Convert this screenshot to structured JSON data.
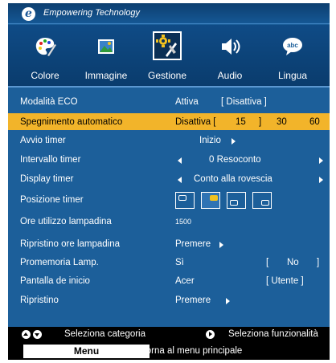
{
  "header": {
    "logo_letter": "e",
    "tagline": "Empowering Technology"
  },
  "tabs": [
    {
      "label": "Colore",
      "icon": "color-palette-icon"
    },
    {
      "label": "Immagine",
      "icon": "image-icon"
    },
    {
      "label": "Gestione",
      "icon": "management-tools-icon",
      "selected": true
    },
    {
      "label": "Audio",
      "icon": "speaker-icon"
    },
    {
      "label": "Lingua",
      "icon": "language-abc-icon"
    }
  ],
  "menu": {
    "eco_mode": {
      "label": "Modalità ECO",
      "on": "Attiva",
      "off": "[ Disattiva ]"
    },
    "auto_shutdown": {
      "label": "Spegnimento automatico",
      "v1": "Disattiva [",
      "v2": "15",
      "v3": "]",
      "v4": "30",
      "v5": "60"
    },
    "timer_start": {
      "label": "Avvio timer",
      "value": "Inizio"
    },
    "timer_interval": {
      "label": "Intervallo timer",
      "value": "0 Resoconto"
    },
    "timer_display": {
      "label": "Display timer",
      "value": "Conto alla rovescia"
    },
    "timer_position": {
      "label": "Posizione timer",
      "selected_index": 1
    },
    "lamp_hours": {
      "label": "Ore utilizzo lampadina",
      "value": "1500"
    },
    "lamp_reset": {
      "label": "Ripristino ore lampadina",
      "value": "Premere"
    },
    "lamp_reminder": {
      "label": "Promemoria Lamp.",
      "on": "Sì",
      "off_open": "[",
      "off": "No",
      "off_close": "]"
    },
    "startup_screen": {
      "label": "Pantalla de inicio",
      "acer": "Acer",
      "user": "[ Utente ]"
    },
    "reset": {
      "label": "Ripristino",
      "value": "Premere"
    }
  },
  "footer": {
    "select_category": "Seleziona categoria",
    "select_function": "Seleziona funzionalità",
    "menu_key": "Menu",
    "menu_desc": "Torna al menu principale"
  },
  "colors": {
    "panel": "#1c5f9a",
    "highlight": "#f2b42a",
    "footer": "#000000"
  }
}
